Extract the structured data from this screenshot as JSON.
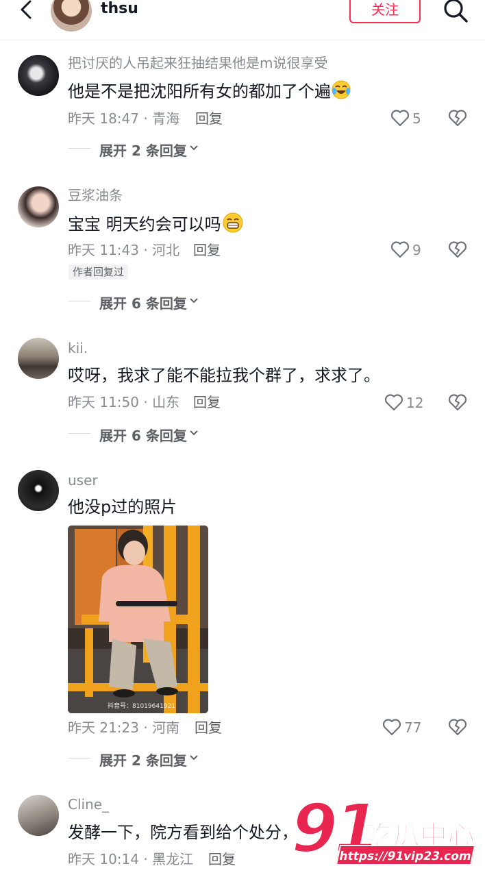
{
  "header": {
    "username": "thsu",
    "follow_label": "关注",
    "icons": [
      "back-arrow-icon",
      "avatar",
      "search-icon"
    ]
  },
  "comments": [
    {
      "username": "把讨厌的人吊起来狂抽结果他是m说很享受",
      "text": "他是不是把沈阳所有女的都加了个遍",
      "emoji": "tears-of-joy-emoji",
      "time": "昨天 18:47 · 青海",
      "reply_label": "回复",
      "likes": "5",
      "expand": "展开 2 条回复"
    },
    {
      "username": "豆浆油条",
      "text": "宝宝  明天约会可以吗",
      "emoji": "grinning-emoji",
      "time": "昨天 11:43 · 河北",
      "reply_label": "回复",
      "likes": "9",
      "badge": "作者回复过",
      "expand": "展开 6 条回复"
    },
    {
      "username": "kii.",
      "text": "哎呀，我求了能不能拉我个群了，求求了。",
      "time": "昨天 11:50 · 山东",
      "reply_label": "回复",
      "likes": "12",
      "expand": "展开 6 条回复"
    },
    {
      "username": "user",
      "text": "他没p过的照片",
      "photo_caption": "抖音号：81019641921",
      "time": "昨天 21:23 · 河南",
      "reply_label": "回复",
      "likes": "77",
      "expand": "展开 2 条回复"
    },
    {
      "username": "Cline_",
      "text": "发酵一下，院方看到给个处分，",
      "time": "昨天 10:14 · 黑龙江",
      "reply_label": "回复"
    }
  ],
  "watermark": {
    "number": "91",
    "text": "吃瓜中心",
    "url": "https://91vip23.com"
  },
  "colors": {
    "accent": "#fe2c55",
    "muted_text": "#8a8b91",
    "primary_text": "#161823"
  }
}
